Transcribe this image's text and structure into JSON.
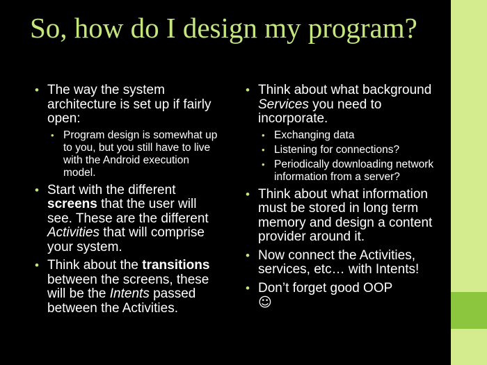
{
  "slide": {
    "title": "So, how do I design my program?",
    "colors": {
      "background": "#000000",
      "title": "#c4e67d",
      "text": "#ffffff",
      "sidebar": "#d4ec8e",
      "sidebar_accent": "#8cc63f"
    },
    "left": {
      "b1": {
        "text": "The way the system architecture is set up if fairly open:"
      },
      "b1_sub1": "Program design is somewhat up to you, but you still have to live with the Android execution model.",
      "b2": {
        "pre": "Start with the different ",
        "strong": "screens",
        "mid": " that the user will see. These are the different ",
        "em": "Activities",
        "post": " that will comprise your system."
      },
      "b3": {
        "pre": "Think about the ",
        "strong": "transitions",
        "mid": " between the screens, these will be the ",
        "em": "Intents",
        "post": " passed between the Activities."
      }
    },
    "right": {
      "b1": {
        "pre": "Think about what background ",
        "em": "Services",
        "post": " you need to incorporate."
      },
      "b1_subs": [
        "Exchanging data",
        "Listening for connections?",
        "Periodically downloading network information from a server?"
      ],
      "b2": "Think about what information must be stored in long term memory and design a content provider around it.",
      "b3": "Now connect the Activities, services, etc… with Intents!",
      "b4": {
        "text": "Don’t forget good OOP",
        "emoticon": "☺"
      }
    }
  }
}
